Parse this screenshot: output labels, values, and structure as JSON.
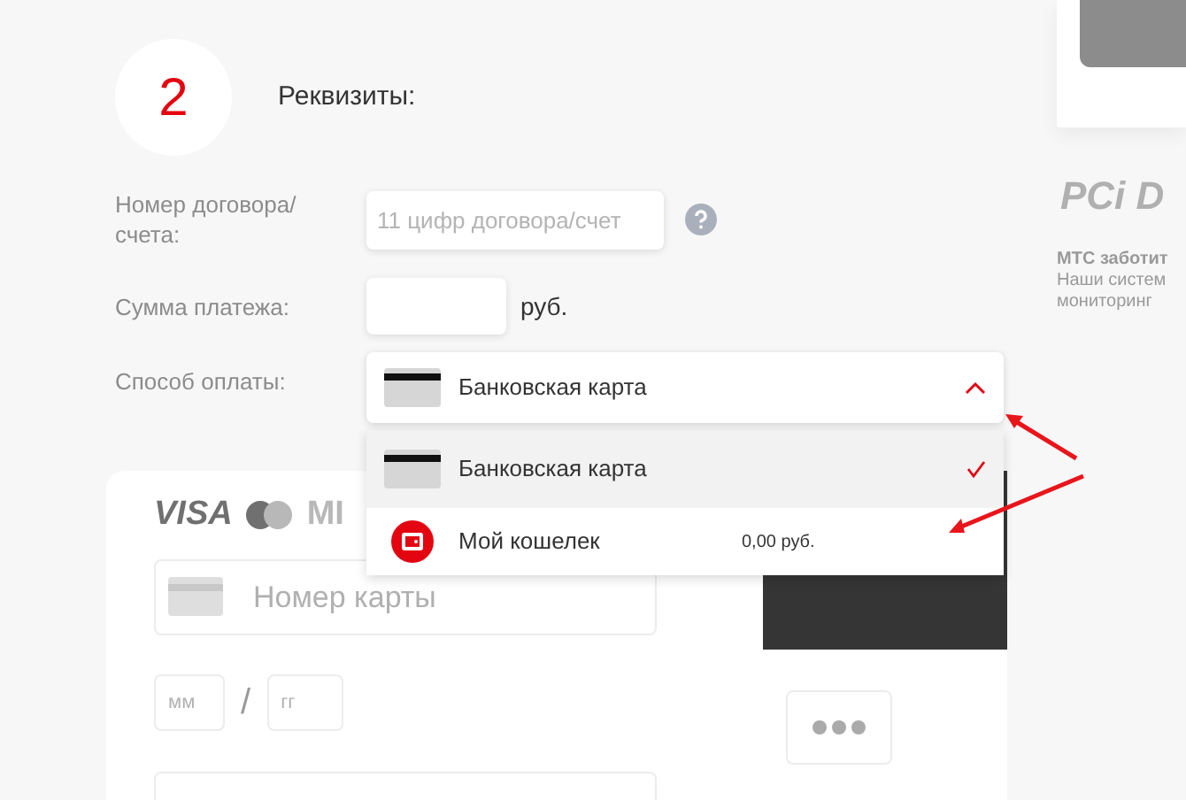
{
  "step": {
    "number": "2",
    "title": "Реквизиты:"
  },
  "fields": [
    {
      "kind": "text",
      "label": "Номер договора/ счета:",
      "placeholder": "11 цифр договора/счет",
      "help": true
    },
    {
      "kind": "amount",
      "label": "Сумма платежа:",
      "suffix": "руб."
    },
    {
      "kind": "select",
      "label": "Способ оплаты:",
      "value": "Банковская карта",
      "expanded": true
    }
  ],
  "payment_options": [
    {
      "kind": "card",
      "label": "Банковская карта",
      "selected": true
    },
    {
      "kind": "wallet",
      "label": "Мой кошелек",
      "amount": "0,00 руб.",
      "selected": false
    }
  ],
  "card_form": {
    "brands": [
      "VISA",
      "MI"
    ],
    "number_placeholder": "Номер карты",
    "month_placeholder": "мм",
    "separator": "/",
    "year_placeholder": "гг"
  },
  "sidebar": {
    "logo": "PCi D",
    "notice_lines": [
      "МТС заботит",
      "Наши систем",
      "мониторинг"
    ]
  }
}
